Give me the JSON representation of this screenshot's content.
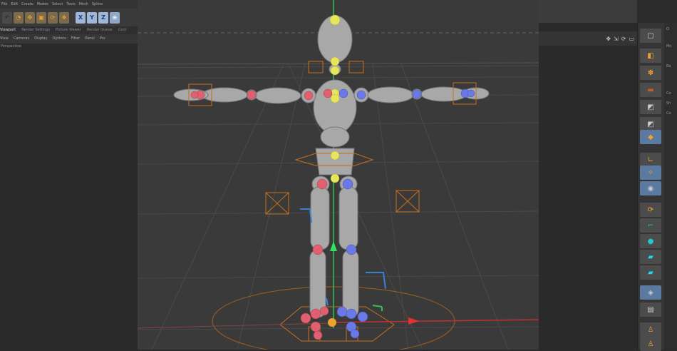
{
  "menu": [
    "File",
    "Edit",
    "Create",
    "Modes",
    "Select",
    "Tools",
    "Mesh",
    "Spline"
  ],
  "toolbar": {
    "axis_x": "X",
    "axis_y": "Y",
    "axis_z": "Z"
  },
  "view_tabs": [
    "Viewport",
    "Render Settings",
    "Picture Viewer",
    "Render Queue",
    "Cont"
  ],
  "view_menu": [
    "View",
    "Cameras",
    "Display",
    "Options",
    "Filter",
    "Panel",
    "Pro"
  ],
  "viewport_label": "Perspective",
  "right_labels": [
    "O",
    "Mo",
    "Ba",
    "Co",
    "Sh",
    "Co"
  ],
  "colors": {
    "accent": "#f0a030",
    "joint_left": "#e06070",
    "joint_right": "#6a78e8",
    "joint_center": "#e8e860",
    "axis_x": "#e83030",
    "axis_y": "#30e060",
    "axis_z": "#3080f0",
    "bone_outline": "#c8701c"
  }
}
